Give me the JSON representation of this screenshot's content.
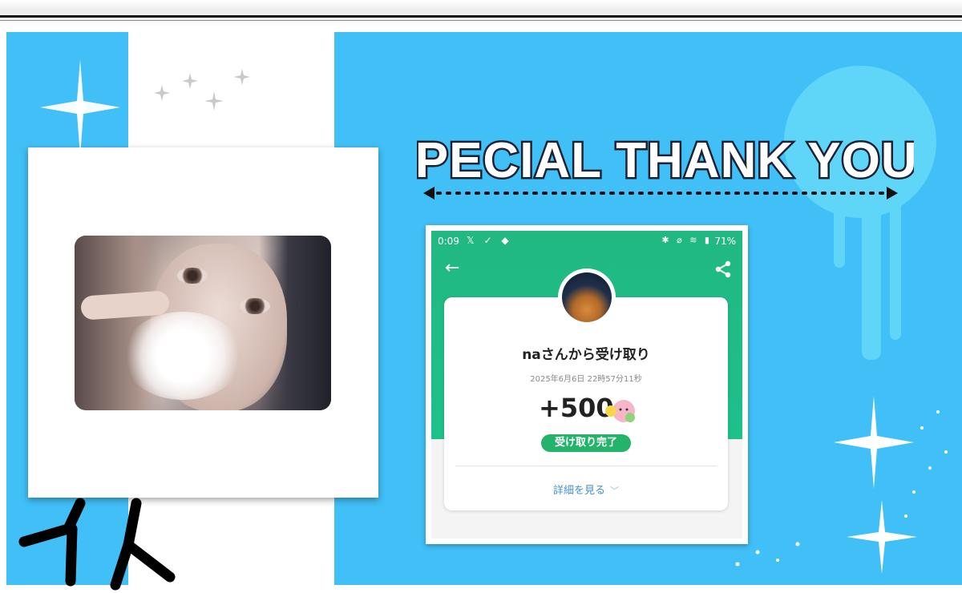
{
  "banner": {
    "title": "SPECIAL THANK YOU"
  },
  "colors": {
    "background_blue": "#41bff7",
    "bubble_blue": "#5fd6f8",
    "app_green": "#1ec08b",
    "badge_green": "#24b36b",
    "link_blue": "#4a8fd6"
  },
  "photo": {
    "description_icon": "portrait-photo"
  },
  "phone": {
    "status_bar": {
      "time": "0:09",
      "battery": "71%",
      "left_icons": "𝕏 ✓ ◆",
      "right_icons": "✱ ⌀ ≋ ▮"
    },
    "card": {
      "title": "naさんから受け取り",
      "date": "2025年6月6日 22時57分11秒",
      "amount": "+500",
      "badge": "受け取り完了",
      "details_link": "詳細を見る",
      "details_chevron": "﹀"
    }
  }
}
